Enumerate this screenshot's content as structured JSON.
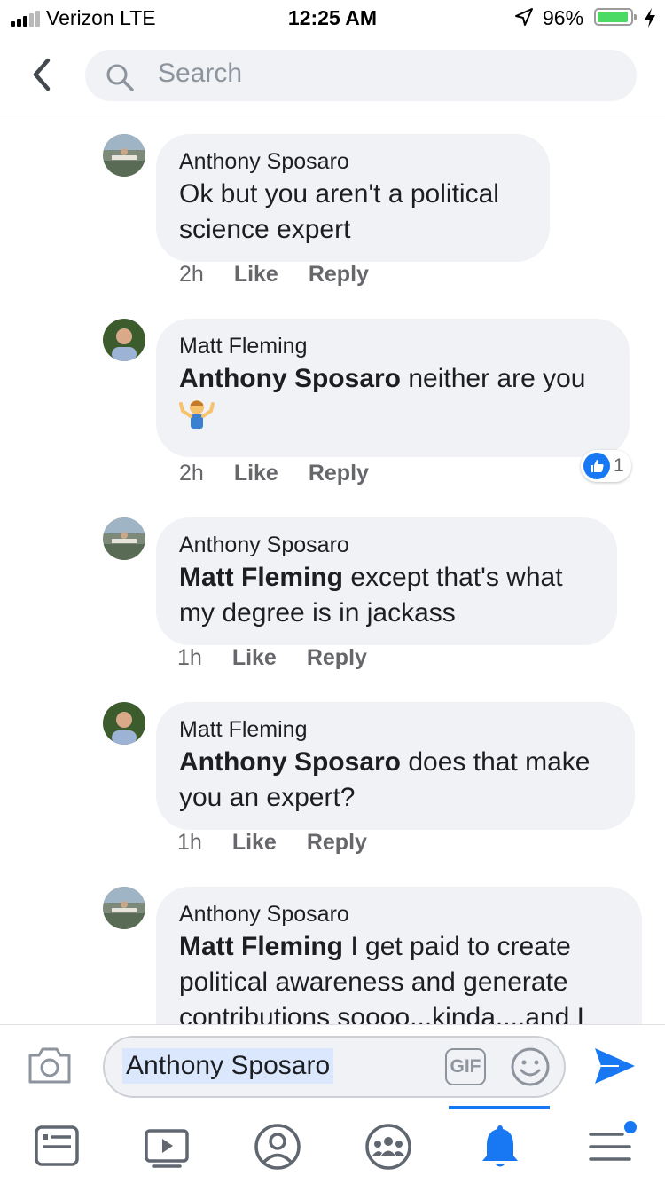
{
  "status_bar": {
    "carrier": "Verizon  LTE",
    "time": "12:25 AM",
    "battery_percent": "96%"
  },
  "header": {
    "search_placeholder": "Search"
  },
  "comments": [
    {
      "author": "Anthony Sposaro",
      "mention": "",
      "text": "Ok but you aren't a political science expert",
      "time": "2h",
      "like_label": "Like",
      "reply_label": "Reply"
    },
    {
      "author": "Matt Fleming",
      "mention": "Anthony Sposaro",
      "text": " neither are you",
      "emoji": "person-shrugging",
      "time": "2h",
      "like_label": "Like",
      "reply_label": "Reply",
      "reaction_count": "1"
    },
    {
      "author": "Anthony Sposaro",
      "mention": "Matt Fleming",
      "text": " except that's what my degree is in jackass",
      "time": "1h",
      "like_label": "Like",
      "reply_label": "Reply"
    },
    {
      "author": "Matt Fleming",
      "mention": "Anthony Sposaro",
      "text": " does that make you an expert?",
      "time": "1h",
      "like_label": "Like",
      "reply_label": "Reply"
    },
    {
      "author": "Anthony Sposaro",
      "mention": "Matt Fleming",
      "text": " I get paid to create political awareness and generate contributions soooo...kinda....and I"
    }
  ],
  "composer": {
    "text": "Anthony Sposaro",
    "gif_label": "GIF"
  },
  "colors": {
    "accent": "#1877f2",
    "bubble": "#f0f2f5",
    "muted_text": "#65676b"
  },
  "tabbar": {
    "items": [
      "news-feed-icon",
      "watch-icon",
      "profile-icon",
      "groups-icon",
      "notifications-icon",
      "menu-icon"
    ],
    "active": "notifications-icon"
  }
}
